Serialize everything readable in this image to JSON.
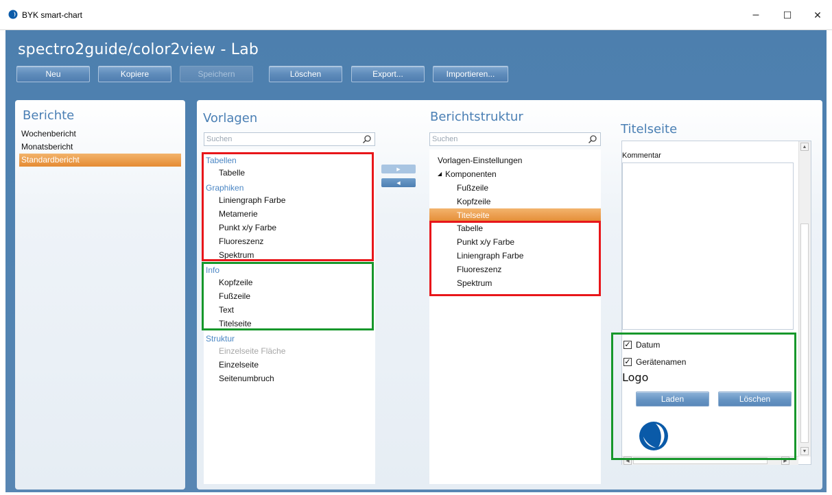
{
  "window": {
    "title": "BYK smart-chart",
    "minimize": "–",
    "maximize": "☐",
    "close": "✕"
  },
  "app": {
    "title": "spectro2guide/color2view - Lab"
  },
  "toolbar": {
    "new": "Neu",
    "copy": "Kopiere",
    "save": "Speichern",
    "delete": "Löschen",
    "export": "Export...",
    "import": "Importieren..."
  },
  "reports": {
    "title": "Berichte",
    "items": [
      "Wochenbericht",
      "Monatsbericht",
      "Standardbericht"
    ],
    "selected_index": 2
  },
  "templates": {
    "title": "Vorlagen",
    "search_placeholder": "Suchen",
    "tables_category": "Tabellen",
    "table": "Tabelle",
    "graphics_category": "Graphiken",
    "line_graph_color": "Liniengraph Farbe",
    "metamerism": "Metamerie",
    "point_xy_color": "Punkt x/y Farbe",
    "fluorescence": "Fluoreszenz",
    "spectrum": "Spektrum",
    "info_category": "Info",
    "header": "Kopfzeile",
    "footer": "Fußzeile",
    "text": "Text",
    "title_page": "Titelseite",
    "structure_category": "Struktur",
    "single_page_area": "Einzelseite Fläche",
    "single_page": "Einzelseite",
    "page_break": "Seitenumbruch"
  },
  "arrows": {
    "add": "▶",
    "remove": "◀"
  },
  "structure": {
    "title": "Berichtstruktur",
    "search_placeholder": "Suchen",
    "template_settings": "Vorlagen-Einstellungen",
    "expander": "◢",
    "components": "Komponenten",
    "footer": "Fußzeile",
    "header": "Kopfzeile",
    "title_page": "Titelseite",
    "table": "Tabelle",
    "point_xy_color": "Punkt x/y Farbe",
    "line_graph_color": "Liniengraph Farbe",
    "fluorescence": "Fluoreszenz",
    "spectrum": "Spektrum"
  },
  "details": {
    "title": "Titelseite",
    "comment_label": "Kommentar",
    "comment_value": "",
    "date_label": "Datum",
    "date_checked": true,
    "device_label": "Gerätenamen",
    "device_checked": true,
    "checkmark": "✓",
    "logo_heading": "Logo",
    "load_button": "Laden",
    "delete_button": "Löschen"
  },
  "scroll": {
    "up": "▲",
    "down": "▼",
    "left": "◀",
    "right": "▶"
  },
  "colors": {
    "app_background": "#4f82b1",
    "selection": "#e58b33",
    "panel_title": "#4a7fb4",
    "category_text": "#4a86c4",
    "highlight_red": "#e8161a",
    "highlight_green": "#16972b",
    "logo_blue": "#0a5aa8"
  }
}
